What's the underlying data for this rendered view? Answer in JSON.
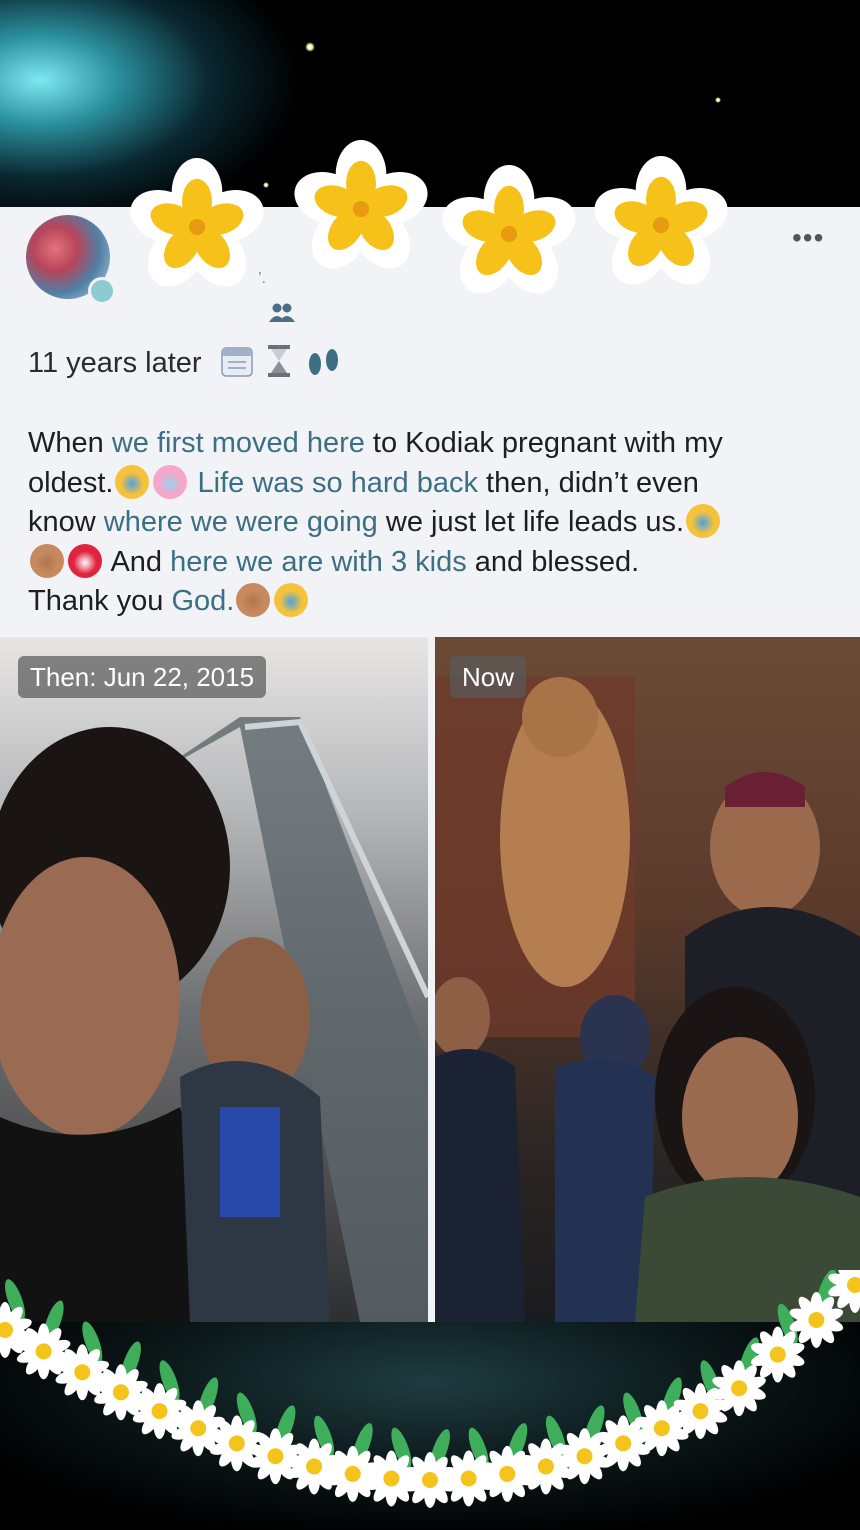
{
  "post": {
    "headline": "11 years later",
    "body_lines": [
      {
        "segments": [
          {
            "t": "When ",
            "c": ""
          },
          {
            "t": "we first moved here",
            "c": "blue"
          },
          {
            "t": " to Kodiak pregnant with my",
            "c": ""
          }
        ]
      },
      {
        "segments": [
          {
            "t": "oldest.",
            "c": ""
          },
          {
            "t": "[cry]",
            "c": "emoji"
          },
          {
            "t": "[heart]",
            "c": "emoji"
          },
          {
            "t": " Life was so hard back",
            "c": "blue"
          },
          {
            "t": " then, didn’t even",
            "c": ""
          }
        ]
      },
      {
        "segments": [
          {
            "t": "know ",
            "c": ""
          },
          {
            "t": "where we were going",
            "c": "blue"
          },
          {
            "t": " we just let life leads us.",
            "c": ""
          },
          {
            "t": "[cry]",
            "c": "emoji"
          }
        ]
      },
      {
        "segments": [
          {
            "t": "[pray]",
            "c": "emoji"
          },
          {
            "t": "[mend]",
            "c": "emoji"
          },
          {
            "t": " And ",
            "c": ""
          },
          {
            "t": "here we are with 3 kids",
            "c": "blue"
          },
          {
            "t": " and blessed.",
            "c": ""
          }
        ]
      },
      {
        "segments": [
          {
            "t": "Thank you ",
            "c": ""
          },
          {
            "t": "God.",
            "c": "blue"
          },
          {
            "t": "[pray]",
            "c": "emoji"
          },
          {
            "t": "[cry]",
            "c": "emoji"
          }
        ]
      }
    ],
    "more_label": "•••",
    "name_fragment": "’."
  },
  "photos": {
    "then_label": "Then: Jun 22, 2015",
    "now_label": "Now"
  },
  "icons": {
    "avatar": "avatar",
    "friends": "friends-icon",
    "calendar": "calendar-icon",
    "hourglass": "hourglass-icon",
    "footprints": "footprints-icon",
    "crying": "crying-face-icon",
    "heart": "sparkling-heart-icon",
    "pray": "folded-hands-icon",
    "mending": "mending-heart-icon"
  },
  "colors": {
    "link_blue": "#3d6f82",
    "card_bg": "#f2f3f7",
    "flower_yellow": "#f6c21a"
  }
}
